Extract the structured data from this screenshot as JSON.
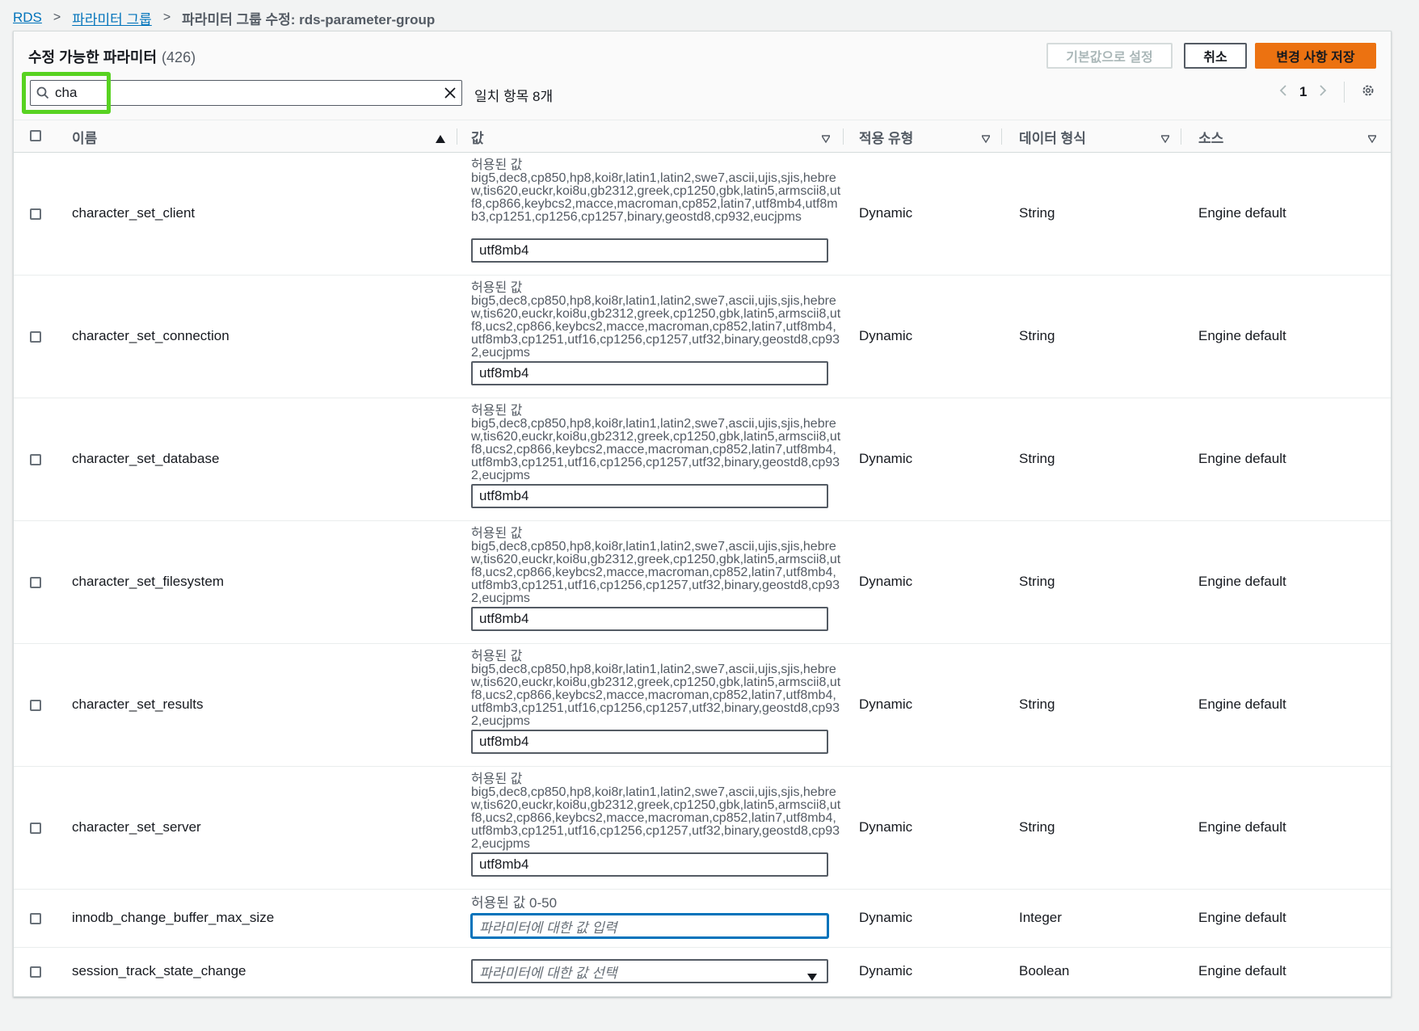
{
  "breadcrumb": {
    "root": "RDS",
    "parent": "파라미터 그룹",
    "current": "파라미터 그룹 수정: rds-parameter-group"
  },
  "panel": {
    "title": "수정 가능한 파라미터",
    "count": "(426)",
    "buttons": {
      "reset": "기본값으로 설정",
      "cancel": "취소",
      "save": "변경 사항 저장"
    },
    "search_value": "cha",
    "match_count": "일치 항목 8개",
    "page": "1"
  },
  "columns": {
    "name": "이름",
    "value": "값",
    "apply_type": "적용 유형",
    "data_type": "데이터 형식",
    "source": "소스"
  },
  "colors": {
    "accent": "#ec7211",
    "link": "#0073bb",
    "highlight": "#58d221"
  },
  "rows": [
    {
      "name": "character_set_client",
      "allowed_label": "허용된 값",
      "allowed": "big5,dec8,cp850,hp8,koi8r,latin1,latin2,swe7,ascii,ujis,sjis,hebrew,tis620,euckr,koi8u,gb2312,greek,cp1250,gbk,latin5,armscii8,utf8,cp866,keybcs2,macce,macroman,cp852,latin7,utf8mb4,utf8mb3,cp1251,cp1256,cp1257,binary,geostd8,cp932,eucjpms",
      "value": "utf8mb4",
      "apply_type": "Dynamic",
      "data_type": "String",
      "source": "Engine default"
    },
    {
      "name": "character_set_connection",
      "allowed_label": "허용된 값",
      "allowed": "big5,dec8,cp850,hp8,koi8r,latin1,latin2,swe7,ascii,ujis,sjis,hebrew,tis620,euckr,koi8u,gb2312,greek,cp1250,gbk,latin5,armscii8,utf8,ucs2,cp866,keybcs2,macce,macroman,cp852,latin7,utf8mb4,utf8mb3,cp1251,utf16,cp1256,cp1257,utf32,binary,geostd8,cp932,eucjpms",
      "value": "utf8mb4",
      "apply_type": "Dynamic",
      "data_type": "String",
      "source": "Engine default"
    },
    {
      "name": "character_set_database",
      "allowed_label": "허용된 값",
      "allowed": "big5,dec8,cp850,hp8,koi8r,latin1,latin2,swe7,ascii,ujis,sjis,hebrew,tis620,euckr,koi8u,gb2312,greek,cp1250,gbk,latin5,armscii8,utf8,ucs2,cp866,keybcs2,macce,macroman,cp852,latin7,utf8mb4,utf8mb3,cp1251,utf16,cp1256,cp1257,utf32,binary,geostd8,cp932,eucjpms",
      "value": "utf8mb4",
      "apply_type": "Dynamic",
      "data_type": "String",
      "source": "Engine default"
    },
    {
      "name": "character_set_filesystem",
      "allowed_label": "허용된 값",
      "allowed": "big5,dec8,cp850,hp8,koi8r,latin1,latin2,swe7,ascii,ujis,sjis,hebrew,tis620,euckr,koi8u,gb2312,greek,cp1250,gbk,latin5,armscii8,utf8,ucs2,cp866,keybcs2,macce,macroman,cp852,latin7,utf8mb4,utf8mb3,cp1251,utf16,cp1256,cp1257,utf32,binary,geostd8,cp932,eucjpms",
      "value": "utf8mb4",
      "apply_type": "Dynamic",
      "data_type": "String",
      "source": "Engine default"
    },
    {
      "name": "character_set_results",
      "allowed_label": "허용된 값",
      "allowed": "big5,dec8,cp850,hp8,koi8r,latin1,latin2,swe7,ascii,ujis,sjis,hebrew,tis620,euckr,koi8u,gb2312,greek,cp1250,gbk,latin5,armscii8,utf8,ucs2,cp866,keybcs2,macce,macroman,cp852,latin7,utf8mb4,utf8mb3,cp1251,utf16,cp1256,cp1257,utf32,binary,geostd8,cp932,eucjpms",
      "value": "utf8mb4",
      "apply_type": "Dynamic",
      "data_type": "String",
      "source": "Engine default"
    },
    {
      "name": "character_set_server",
      "allowed_label": "허용된 값",
      "allowed": "big5,dec8,cp850,hp8,koi8r,latin1,latin2,swe7,ascii,ujis,sjis,hebrew,tis620,euckr,koi8u,gb2312,greek,cp1250,gbk,latin5,armscii8,utf8,ucs2,cp866,keybcs2,macce,macroman,cp852,latin7,utf8mb4,utf8mb3,cp1251,utf16,cp1256,cp1257,utf32,binary,geostd8,cp932,eucjpms",
      "value": "utf8mb4",
      "apply_type": "Dynamic",
      "data_type": "String",
      "source": "Engine default"
    },
    {
      "name": "innodb_change_buffer_max_size",
      "allowed_label": "허용된 값 0-50",
      "placeholder": "파라미터에 대한 값 입력",
      "apply_type": "Dynamic",
      "data_type": "Integer",
      "source": "Engine default"
    },
    {
      "name": "session_track_state_change",
      "placeholder": "파라미터에 대한 값 선택",
      "apply_type": "Dynamic",
      "data_type": "Boolean",
      "source": "Engine default"
    }
  ]
}
